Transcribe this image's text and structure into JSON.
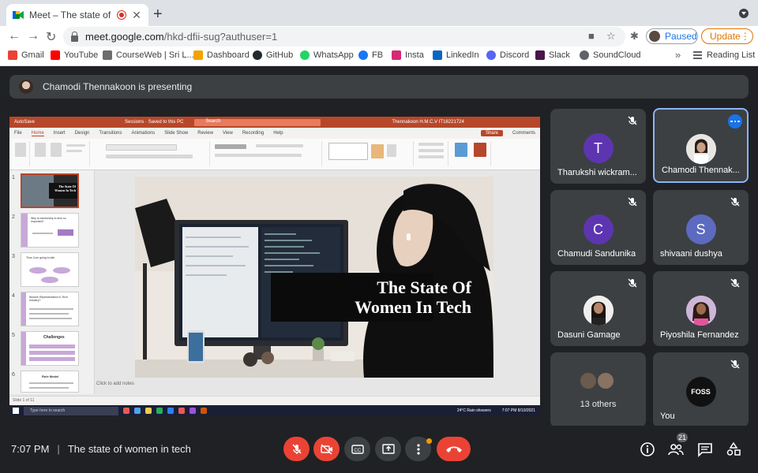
{
  "browser": {
    "tab_title": "Meet – The state of women",
    "url_host": "meet.google.com",
    "url_path": "/hkd-dfii-sug?authuser=1",
    "paused_label": "Paused",
    "update_label": "Update",
    "bookmarks": [
      "Gmail",
      "YouTube",
      "CourseWeb | Sri L...",
      "Dashboard",
      "GitHub",
      "WhatsApp",
      "FB",
      "Insta",
      "LinkedIn",
      "Discord",
      "Slack",
      "SoundCloud"
    ],
    "reading_list": "Reading List"
  },
  "presenting_banner": "Chamodi Thennakoon is presenting",
  "powerpoint": {
    "title_left": "AutoSave",
    "title_file": "Sessions · Saved to this PC",
    "title_search": "Search",
    "title_user": "Thennakoon H.M.C.V IT18221724",
    "tabs": [
      "File",
      "Home",
      "Insert",
      "Design",
      "Transitions",
      "Animations",
      "Slide Show",
      "Review",
      "View",
      "Recording",
      "Help"
    ],
    "share": "Share",
    "comments": "Comments",
    "slide_title_line1": "The State Of",
    "slide_title_line2": "Women In Tech",
    "thumb_labels": [
      "The State Of Women In Tech",
      "Why is mentorship in tech so important?",
      "Thus Com going to talk",
      "Women Representation in Tech Industry?",
      "Challenges",
      "Role Model"
    ],
    "add_notes": "Click to add notes",
    "status": "Slide 1 of 11",
    "taskbar_search": "Type here to search",
    "weather": "24°C  Rain showers",
    "clock": "7:07 PM 8/10/2021"
  },
  "participants": [
    {
      "name": "Tharukshi wickram...",
      "initial": "T",
      "color": "#5e35b1"
    },
    {
      "name": "Chamodi Thennak...",
      "initial": "",
      "color": "#d9d9d9"
    },
    {
      "name": "Chamudi Sandunika",
      "initial": "C",
      "color": "#5e35b1"
    },
    {
      "name": "shivaani dushya",
      "initial": "S",
      "color": "#5c6bc0"
    },
    {
      "name": "Dasuni Gamage",
      "initial": "",
      "color": "#e8e8e8"
    },
    {
      "name": "Piyoshila Fernandez",
      "initial": "",
      "color": "#d8c7e0"
    }
  ],
  "others_label": "13 others",
  "self_label": "You",
  "self_logo": "FOSS",
  "meeting": {
    "time": "7:07 PM",
    "separator": "|",
    "title": "The state of women in tech",
    "participant_count": "21"
  },
  "colors": {
    "mic_off": "#ea4335",
    "accent": "#8ab4f8",
    "ppt_red": "#b7472a"
  }
}
